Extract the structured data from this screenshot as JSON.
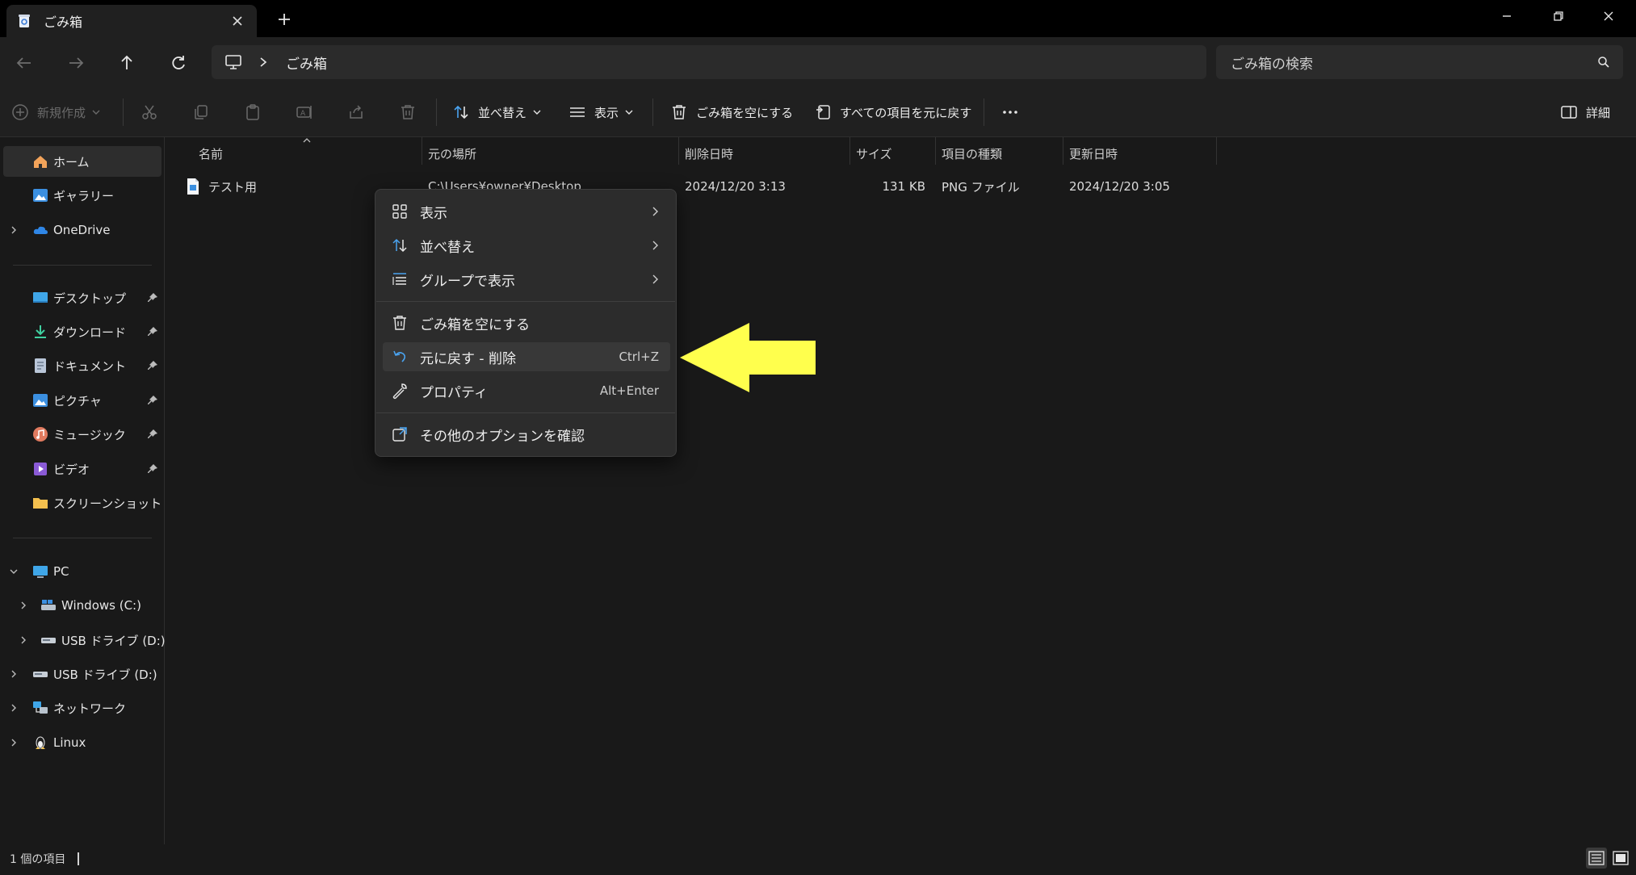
{
  "window": {
    "tab_title": "ごみ箱",
    "new_tab": "+"
  },
  "address": {
    "breadcrumb": "ごみ箱",
    "search_placeholder": "ごみ箱の検索"
  },
  "toolbar": {
    "new_label": "新規作成",
    "sort_label": "並べ替え",
    "view_label": "表示",
    "empty_label": "ごみ箱を空にする",
    "restore_all_label": "すべての項目を元に戻す",
    "details_label": "詳細"
  },
  "sidebar": {
    "items": [
      {
        "label": "ホーム",
        "icon": "home-icon"
      },
      {
        "label": "ギャラリー",
        "icon": "gallery-icon"
      },
      {
        "label": "OneDrive",
        "icon": "cloud-icon"
      },
      {
        "label": "デスクトップ",
        "icon": "desktop-icon"
      },
      {
        "label": "ダウンロード",
        "icon": "download-icon"
      },
      {
        "label": "ドキュメント",
        "icon": "document-icon"
      },
      {
        "label": "ピクチャ",
        "icon": "pictures-icon"
      },
      {
        "label": "ミュージック",
        "icon": "music-icon"
      },
      {
        "label": "ビデオ",
        "icon": "video-icon"
      },
      {
        "label": "スクリーンショット",
        "icon": "folder-icon"
      },
      {
        "label": "PC",
        "icon": "pc-icon"
      },
      {
        "label": "Windows (C:)",
        "icon": "drive-icon"
      },
      {
        "label": "USB ドライブ (D:)",
        "icon": "usb-drive-icon"
      },
      {
        "label": "USB ドライブ (D:)",
        "icon": "usb-drive-icon"
      },
      {
        "label": "ネットワーク",
        "icon": "network-icon"
      },
      {
        "label": "Linux",
        "icon": "linux-icon"
      }
    ]
  },
  "columns": [
    "名前",
    "元の場所",
    "削除日時",
    "サイズ",
    "項目の種類",
    "更新日時"
  ],
  "files": [
    {
      "name": "テスト用",
      "location": "C:\\Users¥owner¥Desktop",
      "deleted": "2024/12/20 3:13",
      "size": "131 KB",
      "type": "PNG ファイル",
      "modified": "2024/12/20 3:05"
    }
  ],
  "context_menu": {
    "items": [
      {
        "label": "表示",
        "icon": "grid-icon",
        "submenu": true
      },
      {
        "label": "並べ替え",
        "icon": "sort-icon",
        "submenu": true
      },
      {
        "label": "グループで表示",
        "icon": "group-list-icon",
        "submenu": true
      },
      {
        "label": "ごみ箱を空にする",
        "icon": "trash-icon"
      },
      {
        "label": "元に戻す - 削除",
        "icon": "undo-icon",
        "shortcut": "Ctrl+Z",
        "highlighted": true
      },
      {
        "label": "プロパティ",
        "icon": "wrench-icon",
        "shortcut": "Alt+Enter"
      },
      {
        "label": "その他のオプションを確認",
        "icon": "share-more-icon"
      }
    ]
  },
  "annotation": {
    "color": "#ffff4d",
    "icon": "arrow-left-icon"
  },
  "status": {
    "item_count": "1 個の項目"
  },
  "colors": {
    "background": "#191919",
    "titlebar": "#000000",
    "accent": "#4aa3f0"
  }
}
